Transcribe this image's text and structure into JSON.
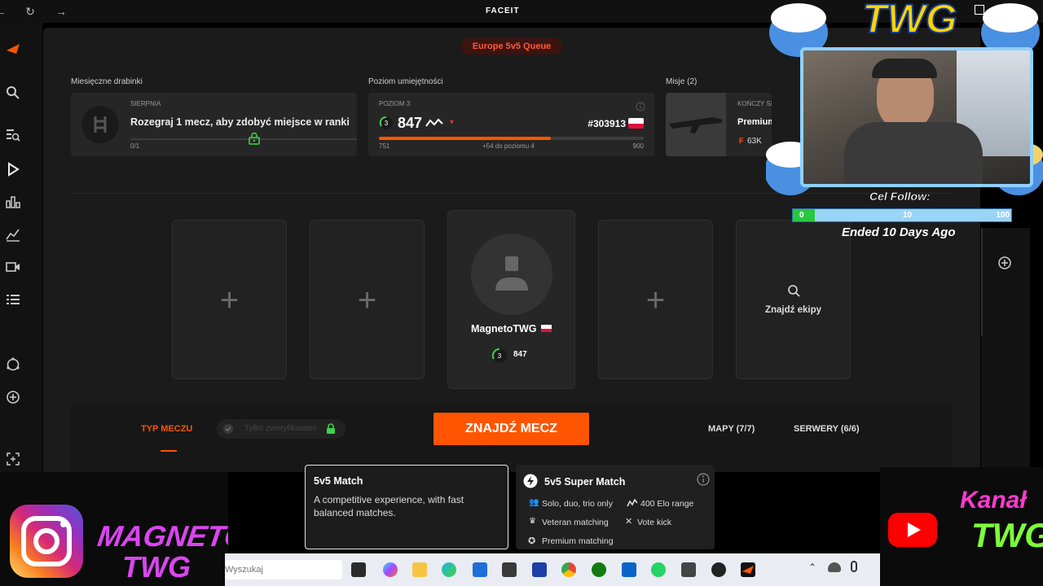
{
  "brand": "FACEIT",
  "queue_badge": "Europe 5v5 Queue",
  "monthly": {
    "section_label": "Miesięczne drabinki",
    "month": "SIERPNIA",
    "text": "Rozegraj 1 mecz, aby zdobyć miejsce w ranki",
    "progress": "0/1"
  },
  "skill": {
    "section_label": "Poziom umiejętności",
    "level_label": "POZIOM 3",
    "level_num": "3",
    "elo": "847",
    "rank": "#303913",
    "range_min": "751",
    "range_max": "900",
    "to_next": "+54 do poziomu 4",
    "progress_fraction": 0.65
  },
  "missions": {
    "section_label": "Misje (2)",
    "ends_label": "KOŃCZY SIĘ ZA",
    "title": "Premium M",
    "reward": "63K"
  },
  "party": {
    "player_name": "MagnetoTWG",
    "player_level": "3",
    "player_elo": "847",
    "find_team": "Znajdź ekipy"
  },
  "controls": {
    "match_type": "TYP MECZU",
    "verified_only": "Tylko zweryfikowani",
    "find_match": "ZNAJDŹ MECZ",
    "maps": "MAPY (7/7)",
    "servers": "SERWERY (6/6)"
  },
  "modes": {
    "match": {
      "title": "5v5 Match",
      "desc": "A competitive experience, with fast balanced matches."
    },
    "super": {
      "title": "5v5 Super Match",
      "f1": "Solo, duo, trio only",
      "f2": "400 Elo range",
      "f3": "Veteran matching",
      "f4": "Vote kick",
      "f5": "Premium matching"
    }
  },
  "stream": {
    "logo_text": "TWG",
    "goal_label": "Cel Follow:",
    "goal_min": "0",
    "goal_current": "10",
    "goal_max": "100",
    "goal_fraction": 0.1,
    "ended": "Ended 10 Days Ago",
    "left_brand_1": "MAGNETO",
    "left_brand_2": "TWG",
    "right_brand_1": "Kanał",
    "right_brand_2": "TWG"
  },
  "taskbar": {
    "search_placeholder": "Wyszukaj"
  }
}
